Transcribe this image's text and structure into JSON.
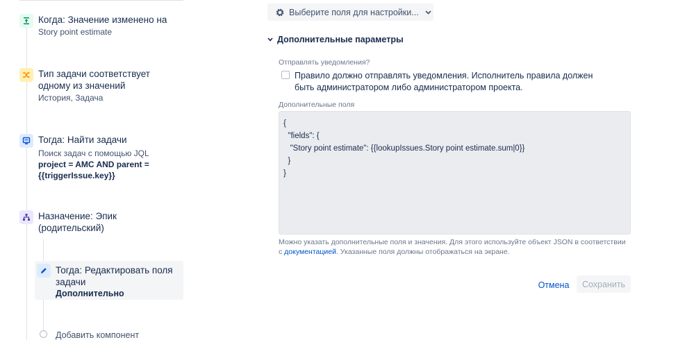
{
  "rules": [
    {
      "title": "Когда: Значение изменено на",
      "subtitle": "Story point estimate",
      "icon": "trigger-icon",
      "icon_bg": "#e3fcef",
      "icon_color": "#00875a"
    },
    {
      "title": "Тип задачи соответствует одному из значений",
      "subtitle": "История, Задача",
      "icon": "shuffle-icon",
      "icon_bg": "#fff0b3",
      "icon_color": "#ff8b00"
    },
    {
      "title": "Тогда: Найти задачи",
      "subtitle": "Поиск задач с помощью JQL",
      "bold": "project = AMC AND parent = {{triggerIssue.key}}",
      "icon": "lookup-icon",
      "icon_bg": "#deebff",
      "icon_color": "#0052cc"
    },
    {
      "title": "Назначение: Эпик (родительский)",
      "icon": "branch-icon",
      "icon_bg": "#eae6ff",
      "icon_color": "#5243aa"
    },
    {
      "title": "Тогда: Редактировать поля задачи",
      "bold": "Дополнительно",
      "icon": "pencil-icon",
      "icon_bg": "#deebff",
      "icon_color": "#0052cc"
    }
  ],
  "add_component": "Добавить компонент",
  "editor": {
    "fields_button": "Выберите поля для настройки...",
    "section_title": "Дополнительные параметры",
    "notify_label": "Отправлять уведомления?",
    "notify_checkbox_label": "Правило должно отправлять уведомления. Исполнитель правила должен быть администратором либо администратором проекта.",
    "additional_fields_label": "Дополнительные поля",
    "json_value": "{\n  \"fields\": {\n   \"Story point estimate\": {{lookupIssues.Story point estimate.sum|0}}\n  }\n}",
    "help_text_1": "Можно указать дополнительные поля и значения. Для этого используйте объект JSON в соответствии с ",
    "help_link": "документацией",
    "help_text_2": ". Указанные поля должны отображаться на экране.",
    "cancel_label": "Отмена",
    "save_label": "Сохранить"
  }
}
